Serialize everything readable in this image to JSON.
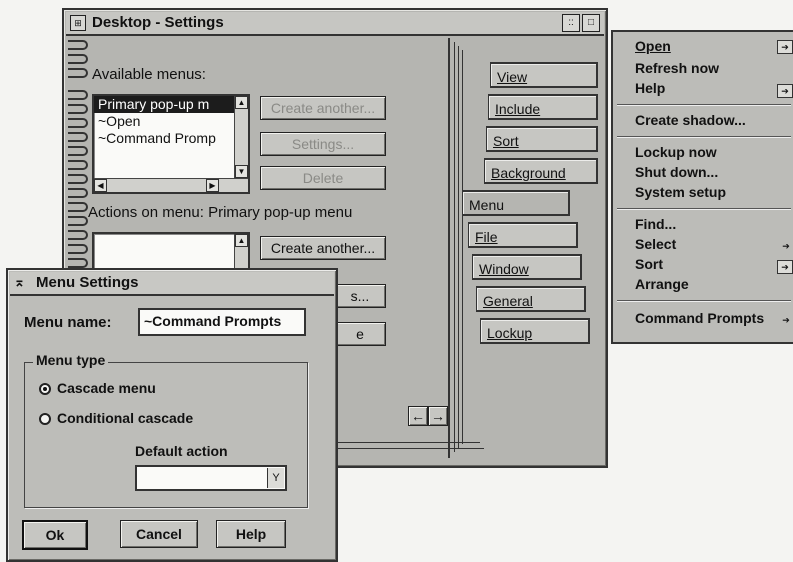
{
  "settings_window": {
    "title": "Desktop - Settings",
    "sysmenu_icon": "window-menu-icon",
    "title_buttons": [
      "::",
      "□"
    ],
    "available_menus_label": "Available menus:",
    "available_menus": [
      "Primary pop-up m",
      "~Open",
      "~Command Promp"
    ],
    "buttons": {
      "create_another": "Create another...",
      "settings": "Settings...",
      "delete": "Delete",
      "create_another_2": "Create another...",
      "settings_2": "s...",
      "delete_2": "e"
    },
    "actions_label": "Actions on menu: Primary pop-up menu",
    "tabs": [
      "View",
      "Include",
      "Sort",
      "Background",
      "Menu",
      "File",
      "Window",
      "General",
      "Lockup"
    ],
    "page_nav": {
      "back": "←",
      "forward": "→"
    }
  },
  "popup_menu": {
    "items": [
      {
        "label": "Open",
        "arrow": true
      },
      {
        "label": "Refresh now",
        "arrow": false
      },
      {
        "label": "Help",
        "arrow": true
      },
      {
        "label": "Create shadow...",
        "arrow": false
      },
      {
        "label": "Lockup now",
        "arrow": false
      },
      {
        "label": "Shut down...",
        "arrow": false
      },
      {
        "label": "System setup",
        "arrow": false
      },
      {
        "label": "Find...",
        "arrow": false
      },
      {
        "label": "Select",
        "arrow": true
      },
      {
        "label": "Sort",
        "arrow": true
      },
      {
        "label": "Arrange",
        "arrow": false
      },
      {
        "label": "Command Prompts",
        "arrow": true
      }
    ]
  },
  "menu_settings_dialog": {
    "title": "Menu Settings",
    "title_icon": "window-menu-icon",
    "menu_name_label": "Menu name:",
    "menu_name_value": "~Command Prompts",
    "menu_type_label": "Menu type",
    "options": [
      "Cascade menu",
      "Conditional cascade"
    ],
    "selected_option": "Cascade menu",
    "default_action_label": "Default action",
    "default_action_value": "",
    "dropdown_icon": "dropdown-icon",
    "buttons": {
      "ok": "Ok",
      "cancel": "Cancel",
      "help": "Help"
    }
  }
}
